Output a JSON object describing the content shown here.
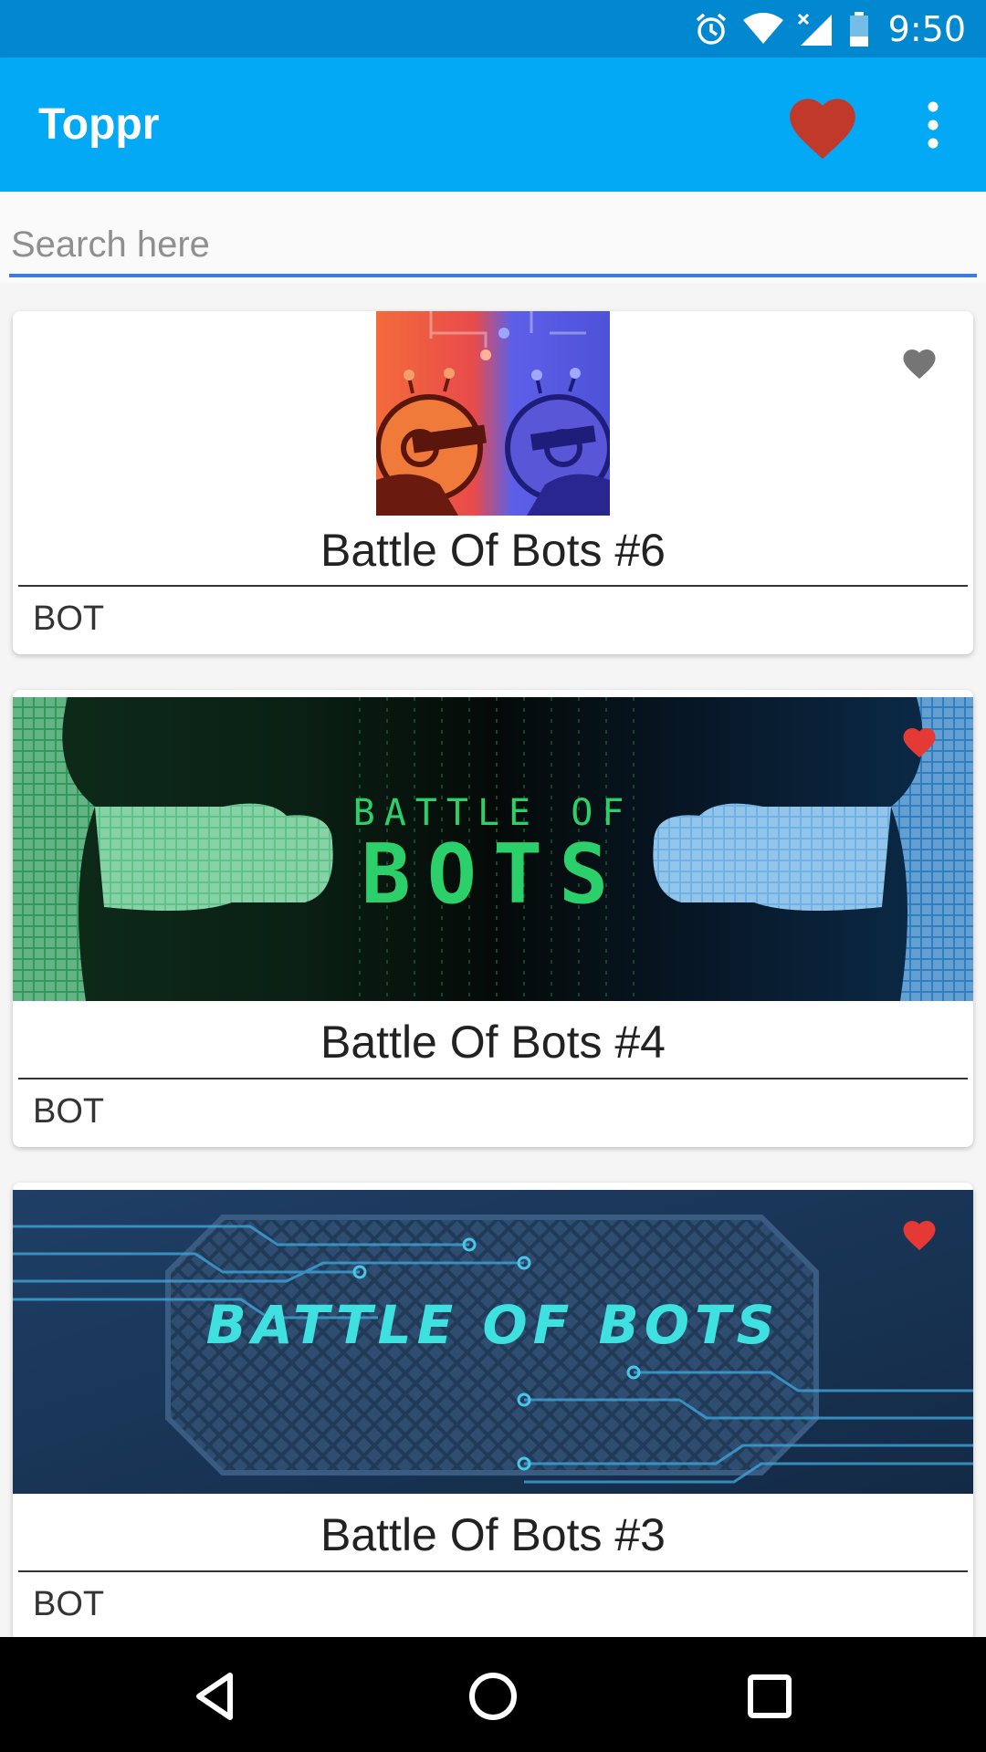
{
  "status_bar": {
    "time": "9:50",
    "icons": [
      "alarm-icon",
      "wifi-icon",
      "signal-icon",
      "battery-icon"
    ],
    "color": "#0288d1"
  },
  "app_bar": {
    "title": "Toppr",
    "color": "#03a9f4",
    "favorites_icon": "heart-icon",
    "menu_icon": "overflow-menu-icon"
  },
  "search": {
    "placeholder": "Search here",
    "value": ""
  },
  "cards": [
    {
      "title": "Battle Of Bots #6",
      "tag": "BOT",
      "favorited": false
    },
    {
      "title": "Battle Of Bots #4",
      "tag": "BOT",
      "favorited": true
    },
    {
      "title": "Battle Of Bots #3",
      "tag": "BOT",
      "favorited": true
    }
  ],
  "colors": {
    "heart_active": "#e53935",
    "heart_inactive": "#757575",
    "appbar_heart": "#c0392b",
    "search_underline": "#3d7be0"
  },
  "nav_bar": {
    "buttons": [
      "back-icon",
      "home-icon",
      "recents-icon"
    ]
  }
}
